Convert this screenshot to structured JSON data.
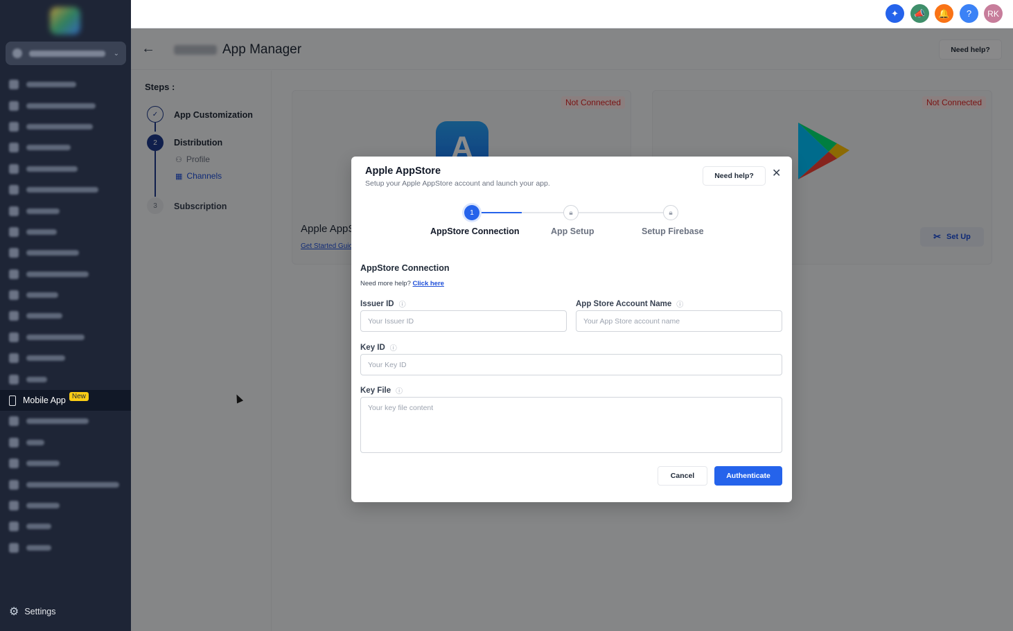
{
  "topbar": {
    "icons": [
      {
        "name": "ai-sparkle-icon",
        "color": "#2563eb",
        "glyph": "✦"
      },
      {
        "name": "megaphone-icon",
        "color": "#3f8f6b",
        "glyph": "📣"
      },
      {
        "name": "bell-icon",
        "color": "#f97316",
        "glyph": "🔔"
      },
      {
        "name": "help-icon",
        "color": "#3b82f6",
        "glyph": "?"
      }
    ],
    "avatar_initials": "RK",
    "avatar_color": "#c77d9b"
  },
  "sidebar": {
    "active_item": {
      "label": "Mobile App",
      "badge": "New"
    },
    "settings_label": "Settings"
  },
  "header": {
    "title": "App Manager",
    "help_label": "Need help?"
  },
  "steps": {
    "title": "Steps :",
    "items": [
      {
        "number": "✓",
        "label": "App Customization"
      },
      {
        "number": "2",
        "label": "Distribution"
      },
      {
        "number": "3",
        "label": "Subscription"
      }
    ],
    "sub_items": [
      {
        "label": "Profile",
        "icon": "person-icon"
      },
      {
        "label": "Channels",
        "icon": "grid-icon"
      }
    ]
  },
  "cards": [
    {
      "status": "Not Connected",
      "title": "Apple AppS",
      "link": "Get Started Guic"
    },
    {
      "status": "Not Connected",
      "button": "Set Up"
    }
  ],
  "modal": {
    "title": "Apple AppStore",
    "subtitle": "Setup your Apple AppStore account and launch your app.",
    "help_label": "Need help?",
    "wizard": [
      {
        "number": "1",
        "label": "AppStore Connection"
      },
      {
        "label": "App Setup"
      },
      {
        "label": "Setup Firebase"
      }
    ],
    "section_title": "AppStore Connection",
    "more_help_text": "Need more help?",
    "more_help_link": "Click here",
    "fields": {
      "issuer_id": {
        "label": "Issuer ID",
        "placeholder": "Your Issuer ID",
        "value": ""
      },
      "account_name": {
        "label": "App Store Account Name",
        "placeholder": "Your App Store account name",
        "value": ""
      },
      "key_id": {
        "label": "Key ID",
        "placeholder": "Your Key ID",
        "value": ""
      },
      "key_file": {
        "label": "Key File",
        "placeholder": "Your key file content",
        "value": ""
      }
    },
    "cancel_label": "Cancel",
    "authenticate_label": "Authenticate"
  },
  "colors": {
    "accent": "#2563eb",
    "sidebar_bg": "#1e2536",
    "not_connected": "#dc2626"
  }
}
